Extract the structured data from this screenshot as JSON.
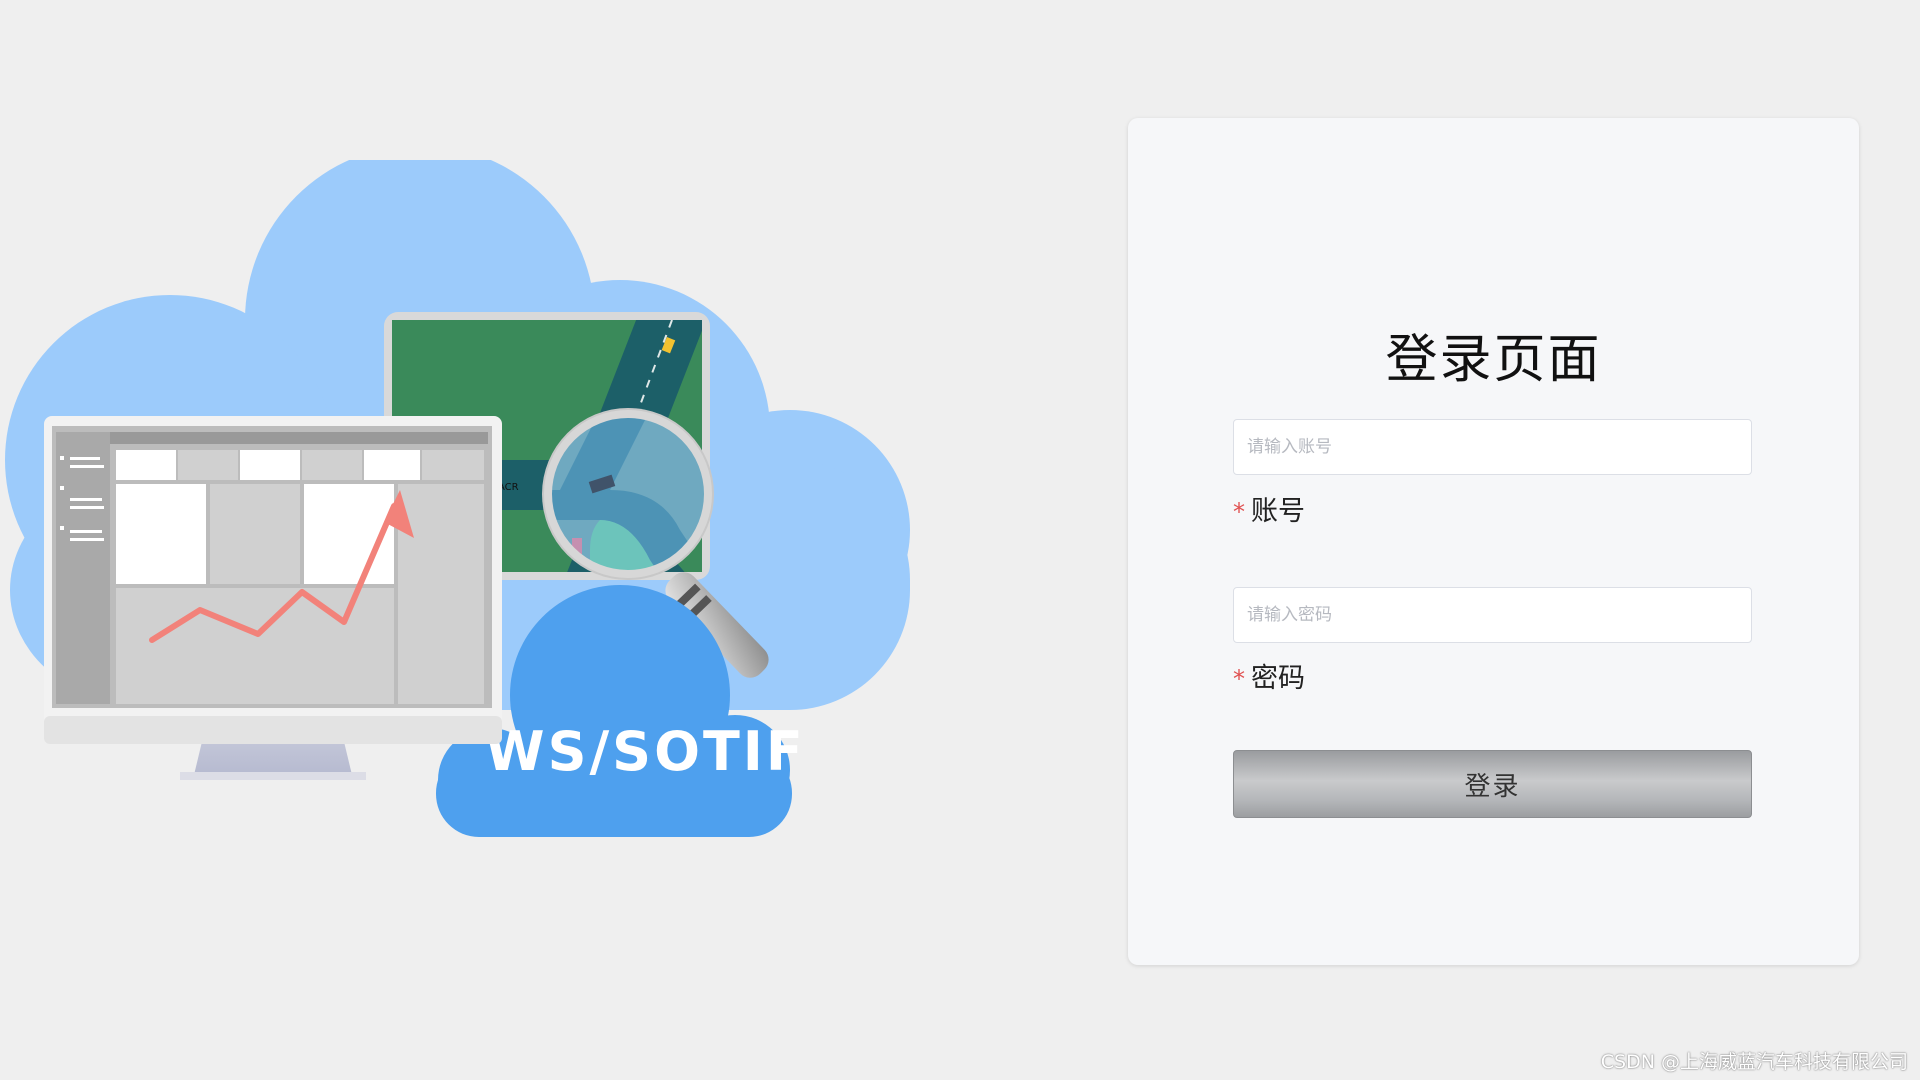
{
  "login": {
    "title": "登录页面",
    "account_label": "账号",
    "account_placeholder": "请输入账号",
    "account_value": "",
    "password_label": "密码",
    "password_placeholder": "请输入密码",
    "password_value": "",
    "required_mark": "*",
    "submit_label": "登录"
  },
  "illustration": {
    "brand_text": "WS/SOTIF"
  },
  "watermark": "CSDN @上海威蓝汽车科技有限公司",
  "colors": {
    "page_background": "#efefef",
    "card_background": "#f6f7f9",
    "cloud_light": "#9ccbfb",
    "cloud_dark": "#4ea0ee",
    "required_star": "#e05050",
    "chart_line": "#f2827a",
    "map_green": "#3a8a5a",
    "road": "#1c5f68"
  },
  "icons": {
    "monitor": "monitor-icon",
    "magnifier": "magnifying-glass-icon",
    "trend": "trend-arrow-icon"
  }
}
